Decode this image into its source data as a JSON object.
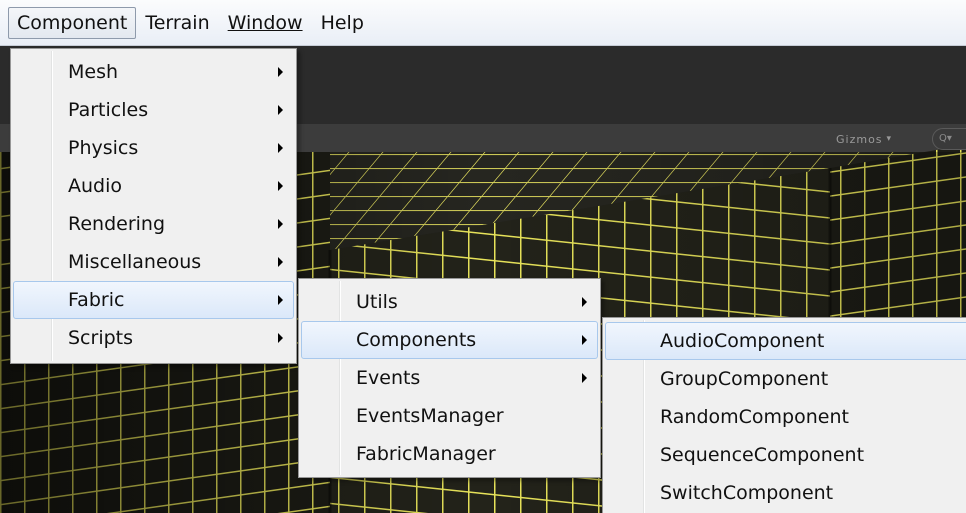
{
  "menubar": {
    "items": [
      {
        "label": "Component",
        "active": true
      },
      {
        "label": "Terrain",
        "active": false
      },
      {
        "label": "Window",
        "active": false
      },
      {
        "label": "Help",
        "active": false
      }
    ]
  },
  "component_menu": {
    "items": [
      {
        "label": "Mesh",
        "submenu": true
      },
      {
        "label": "Particles",
        "submenu": true
      },
      {
        "label": "Physics",
        "submenu": true
      },
      {
        "label": "Audio",
        "submenu": true
      },
      {
        "label": "Rendering",
        "submenu": true
      },
      {
        "label": "Miscellaneous",
        "submenu": true
      },
      {
        "label": "Fabric",
        "submenu": true,
        "highlighted": true
      },
      {
        "label": "Scripts",
        "submenu": true
      }
    ]
  },
  "fabric_menu": {
    "items": [
      {
        "label": "Utils",
        "submenu": true
      },
      {
        "label": "Components",
        "submenu": true,
        "highlighted": true
      },
      {
        "label": "Events",
        "submenu": true
      },
      {
        "label": "EventsManager",
        "submenu": false
      },
      {
        "label": "FabricManager",
        "submenu": false
      }
    ]
  },
  "components_menu": {
    "items": [
      {
        "label": "AudioComponent",
        "highlighted": true
      },
      {
        "label": "GroupComponent"
      },
      {
        "label": "RandomComponent"
      },
      {
        "label": "SequenceComponent"
      },
      {
        "label": "SwitchComponent"
      }
    ]
  },
  "scene_toolbar": {
    "gizmos_label": "Gizmos",
    "search_placeholder": "Q▾"
  },
  "colors": {
    "grid_line": "#e8e45a",
    "scene_dark": "#1b1b14",
    "menu_bg": "#f0f0f0",
    "highlight_border": "#a8c8ec"
  }
}
